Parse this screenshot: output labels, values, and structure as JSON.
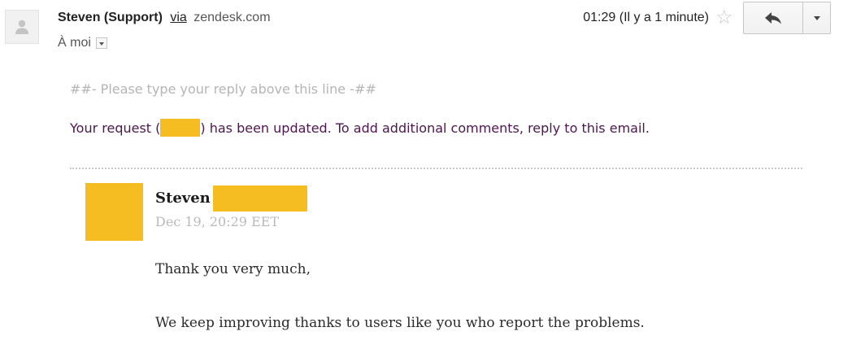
{
  "header": {
    "sender_name": "Steven (Support)",
    "via_label": "via",
    "domain": "zendesk.com",
    "recipient_label": "À moi",
    "time": "01:29 (Il y a 1 minute)"
  },
  "icons": {
    "avatar": "person-icon",
    "star": "star-icon",
    "reply": "reply-icon",
    "more": "chevron-down-icon",
    "recipient_details": "chevron-down-icon"
  },
  "message": {
    "reply_separator": "##- Please type your reply above this line -##",
    "request_prefix": "Your request (",
    "request_suffix": ") has been updated. To add additional comments, reply to this email."
  },
  "comment": {
    "author": "Steven",
    "date": "Dec 19, 20:29 EET",
    "paragraphs": [
      "Thank you very much,",
      "We keep improving thanks to users like you who report the problems."
    ]
  },
  "colors": {
    "redaction": "#f5bd22",
    "request_text": "#4e1550",
    "muted": "#b5b5b5"
  }
}
